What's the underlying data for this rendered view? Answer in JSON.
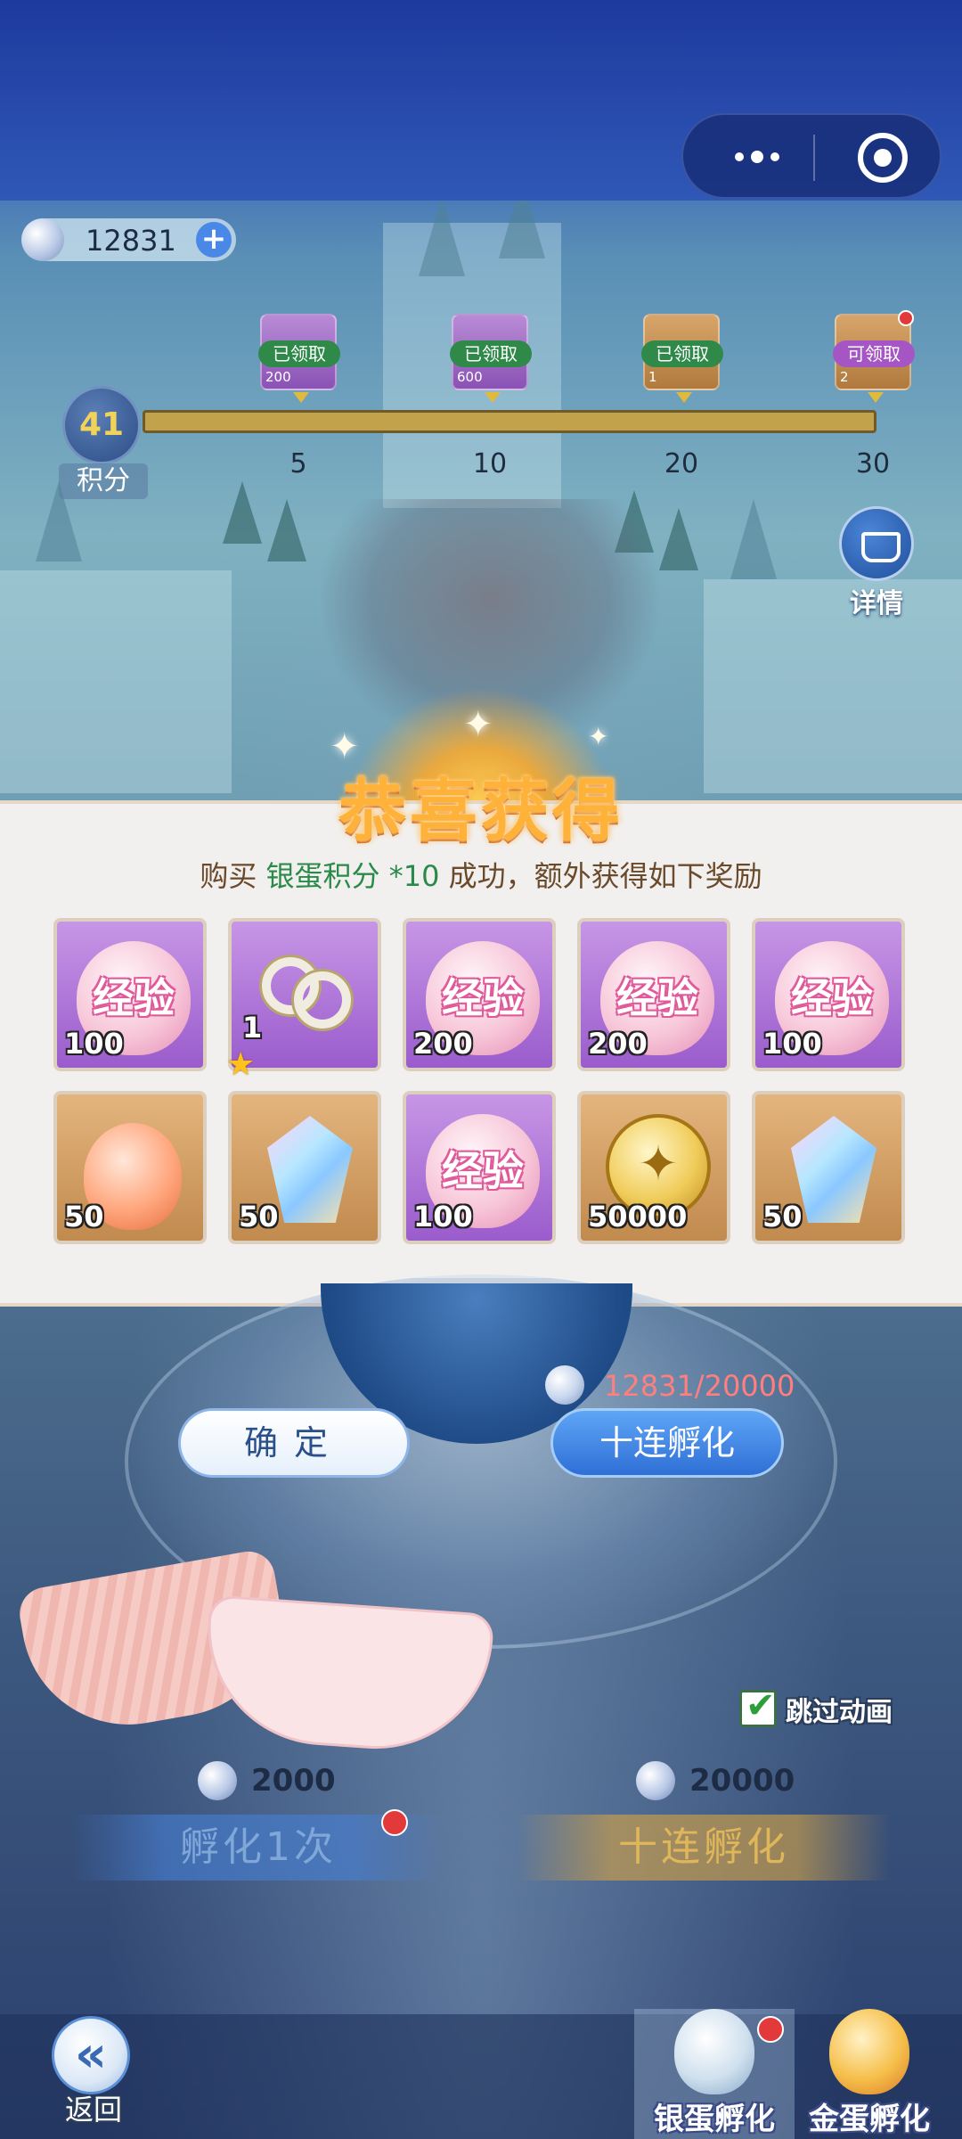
{
  "currency": {
    "value": "12831",
    "plus_icon": "plus-icon"
  },
  "progress": {
    "score": "41",
    "score_label": "积分",
    "milestones": [
      {
        "label": "5",
        "status": "已领取",
        "qty": "200",
        "color": "purple"
      },
      {
        "label": "10",
        "status": "已领取",
        "qty": "600",
        "color": "purple"
      },
      {
        "label": "20",
        "status": "已领取",
        "qty": "1",
        "color": "orange"
      },
      {
        "label": "30",
        "status": "可领取",
        "qty": "2",
        "color": "orange"
      }
    ]
  },
  "details_label": "详情",
  "popup": {
    "title": "恭喜获得",
    "msg_prefix": "购买 ",
    "msg_highlight": "银蛋积分 *10",
    "msg_suffix": " 成功，额外获得如下奖励",
    "exp_label": "经验",
    "items": [
      {
        "kind": "exp-egg",
        "amount": "100",
        "bg": "purple"
      },
      {
        "kind": "ring",
        "amount": "1",
        "bg": "purple"
      },
      {
        "kind": "exp-egg",
        "amount": "200",
        "bg": "purple"
      },
      {
        "kind": "exp-egg",
        "amount": "200",
        "bg": "purple"
      },
      {
        "kind": "exp-egg",
        "amount": "100",
        "bg": "purple"
      },
      {
        "kind": "sun-egg",
        "amount": "50",
        "bg": "orange"
      },
      {
        "kind": "crystal",
        "amount": "50",
        "bg": "orange"
      },
      {
        "kind": "exp-egg",
        "amount": "100",
        "bg": "purple"
      },
      {
        "kind": "gold-coin",
        "amount": "50000",
        "bg": "orange"
      },
      {
        "kind": "crystal",
        "amount": "50",
        "bg": "orange"
      }
    ]
  },
  "actions": {
    "confirm_label": "确定",
    "ten_cost": "12831/20000",
    "ten_label": "十连孵化"
  },
  "skip_animation": {
    "label": "跳过动画",
    "checked": true
  },
  "hatch": {
    "single_cost": "2000",
    "single_label": "孵化1次",
    "ten_cost": "20000",
    "ten_label": "十连孵化"
  },
  "bottom": {
    "back_label": "返回",
    "tabs": [
      {
        "label": "银蛋孵化"
      },
      {
        "label": "金蛋孵化"
      }
    ]
  },
  "colors": {
    "accent_blue": "#2f6fd6",
    "gold": "#ffb23a",
    "highlight_green": "#2a8a4a"
  }
}
